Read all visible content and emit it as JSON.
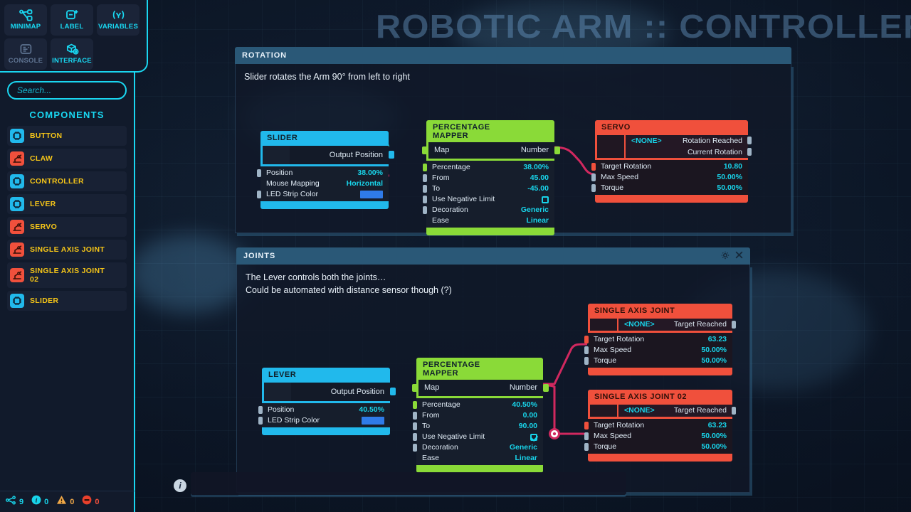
{
  "window": {
    "watermark_title": "ROBOTIC ARM :: CONTROLLER"
  },
  "toolbar": {
    "buttons": [
      {
        "label": "MINIMAP",
        "icon": "minimap-icon",
        "active": true
      },
      {
        "label": "LABEL",
        "icon": "label-plus-icon",
        "active": true
      },
      {
        "label": "VARIABLES",
        "icon": "variables-icon",
        "active": true
      },
      {
        "label": "CONSOLE",
        "icon": "console-icon",
        "active": false
      },
      {
        "label": "INTERFACE",
        "icon": "interface-icon",
        "active": true
      }
    ]
  },
  "sidebar": {
    "search": {
      "placeholder": "Search...",
      "value": ""
    },
    "section_title": "COMPONENTS",
    "items": [
      {
        "label": "BUTTON",
        "icon": "chip-icon",
        "color": "blue"
      },
      {
        "label": "CLAW",
        "icon": "robot-arm-icon",
        "color": "red"
      },
      {
        "label": "CONTROLLER",
        "icon": "chip-icon",
        "color": "blue"
      },
      {
        "label": "LEVER",
        "icon": "chip-icon",
        "color": "blue"
      },
      {
        "label": "SERVO",
        "icon": "robot-arm-icon",
        "color": "red"
      },
      {
        "label": "SINGLE AXIS JOINT",
        "icon": "robot-arm-icon",
        "color": "red"
      },
      {
        "label": "SINGLE AXIS JOINT 02",
        "icon": "robot-arm-icon",
        "color": "red"
      },
      {
        "label": "SLIDER",
        "icon": "chip-icon",
        "color": "blue"
      }
    ]
  },
  "status_bar": {
    "items": [
      {
        "icon": "nodes-icon",
        "count": "9",
        "color": "#18d4ea"
      },
      {
        "icon": "info-icon",
        "count": "0",
        "color": "#18d4ea"
      },
      {
        "icon": "warning-icon",
        "count": "0",
        "color": "#f0a848"
      },
      {
        "icon": "error-icon",
        "count": "0",
        "color": "#f0503c"
      }
    ]
  },
  "panels": [
    {
      "id": "rotation",
      "title": "ROTATION",
      "description_lines": [
        "Slider rotates the Arm 90° from left to right"
      ],
      "header_icons": []
    },
    {
      "id": "joints",
      "title": "JOINTS",
      "description_lines": [
        "The Lever controls both the joints…",
        "Could be automated with distance sensor though (?)"
      ],
      "header_icons": [
        "gear-icon",
        "close-icon"
      ]
    }
  ],
  "nodes": {
    "slider": {
      "title": "SLIDER",
      "accent": "#21b9ec",
      "out_ports": [
        {
          "label": "Output Position",
          "socket": "cyan"
        }
      ],
      "fields": [
        {
          "label": "Position",
          "value": "38.00%",
          "type": "number",
          "socket": "grey"
        },
        {
          "label": "Mouse Mapping",
          "value": "Horizontal",
          "type": "enum",
          "socket": "none"
        },
        {
          "label": "LED Strip Color",
          "value": "#2f7be8",
          "type": "color",
          "socket": "grey"
        }
      ]
    },
    "mapper_rotation": {
      "title": "PERCENTAGE MAPPER",
      "accent": "#8ada38",
      "in_ports": [
        {
          "label": "Map",
          "socket": "green"
        }
      ],
      "out_ports": [
        {
          "label": "Number",
          "socket": "green"
        }
      ],
      "fields": [
        {
          "label": "Percentage",
          "value": "38.00%",
          "type": "number",
          "socket": "green"
        },
        {
          "label": "From",
          "value": "45.00",
          "type": "number",
          "socket": "grey"
        },
        {
          "label": "To",
          "value": "-45.00",
          "type": "number",
          "socket": "grey"
        },
        {
          "label": "Use Negative Limit",
          "value": "false",
          "type": "checkbox",
          "socket": "grey"
        },
        {
          "label": "Decoration",
          "value": "Generic",
          "type": "enum",
          "socket": "grey"
        },
        {
          "label": "Ease",
          "value": "Linear",
          "type": "enum",
          "socket": "none"
        }
      ]
    },
    "servo": {
      "title": "SERVO",
      "accent": "#f0503c",
      "target_label": "<NONE>",
      "out_ports": [
        {
          "label": "Rotation Reached",
          "socket": "grey"
        },
        {
          "label": "Current Rotation",
          "socket": "grey"
        }
      ],
      "fields": [
        {
          "label": "Target Rotation",
          "value": "10.80",
          "type": "number",
          "socket": "red"
        },
        {
          "label": "Max Speed",
          "value": "50.00%",
          "type": "number",
          "socket": "grey"
        },
        {
          "label": "Torque",
          "value": "50.00%",
          "type": "number",
          "socket": "grey"
        }
      ]
    },
    "lever": {
      "title": "LEVER",
      "accent": "#21b9ec",
      "out_ports": [
        {
          "label": "Output Position",
          "socket": "cyan"
        }
      ],
      "fields": [
        {
          "label": "Position",
          "value": "40.50%",
          "type": "number",
          "socket": "grey"
        },
        {
          "label": "LED Strip Color",
          "value": "#2f7be8",
          "type": "color",
          "socket": "grey"
        }
      ]
    },
    "mapper_joints": {
      "title": "PERCENTAGE MAPPER",
      "accent": "#8ada38",
      "in_ports": [
        {
          "label": "Map",
          "socket": "green"
        }
      ],
      "out_ports": [
        {
          "label": "Number",
          "socket": "green"
        }
      ],
      "fields": [
        {
          "label": "Percentage",
          "value": "40.50%",
          "type": "number",
          "socket": "green"
        },
        {
          "label": "From",
          "value": "0.00",
          "type": "number",
          "socket": "grey"
        },
        {
          "label": "To",
          "value": "90.00",
          "type": "number",
          "socket": "grey"
        },
        {
          "label": "Use Negative Limit",
          "value": "true",
          "type": "checkbox",
          "socket": "grey"
        },
        {
          "label": "Decoration",
          "value": "Generic",
          "type": "enum",
          "socket": "grey"
        },
        {
          "label": "Ease",
          "value": "Linear",
          "type": "enum",
          "socket": "none"
        }
      ]
    },
    "joint1": {
      "title": "SINGLE AXIS JOINT",
      "accent": "#f0503c",
      "target_label": "<NONE>",
      "out_ports": [
        {
          "label": "Target Reached",
          "socket": "grey"
        }
      ],
      "fields": [
        {
          "label": "Target Rotation",
          "value": "63.23",
          "type": "number",
          "socket": "red"
        },
        {
          "label": "Max Speed",
          "value": "50.00%",
          "type": "number",
          "socket": "grey"
        },
        {
          "label": "Torque",
          "value": "50.00%",
          "type": "number",
          "socket": "grey"
        }
      ]
    },
    "joint2": {
      "title": "SINGLE AXIS JOINT 02",
      "accent": "#f0503c",
      "target_label": "<NONE>",
      "out_ports": [
        {
          "label": "Target Reached",
          "socket": "grey"
        }
      ],
      "fields": [
        {
          "label": "Target Rotation",
          "value": "63.23",
          "type": "number",
          "socket": "red"
        },
        {
          "label": "Max Speed",
          "value": "50.00%",
          "type": "number",
          "socket": "grey"
        },
        {
          "label": "Torque",
          "value": "50.00%",
          "type": "number",
          "socket": "grey"
        }
      ]
    }
  },
  "canvas": {
    "info_button_label": "i"
  },
  "colors": {
    "cyan": "#18d4ea",
    "green": "#8ada38",
    "red": "#f0503c",
    "yellow": "#f5c518",
    "wire_teal": "#2aa596",
    "wire_pink": "#d1285f",
    "panel_header": "#2a5877"
  }
}
